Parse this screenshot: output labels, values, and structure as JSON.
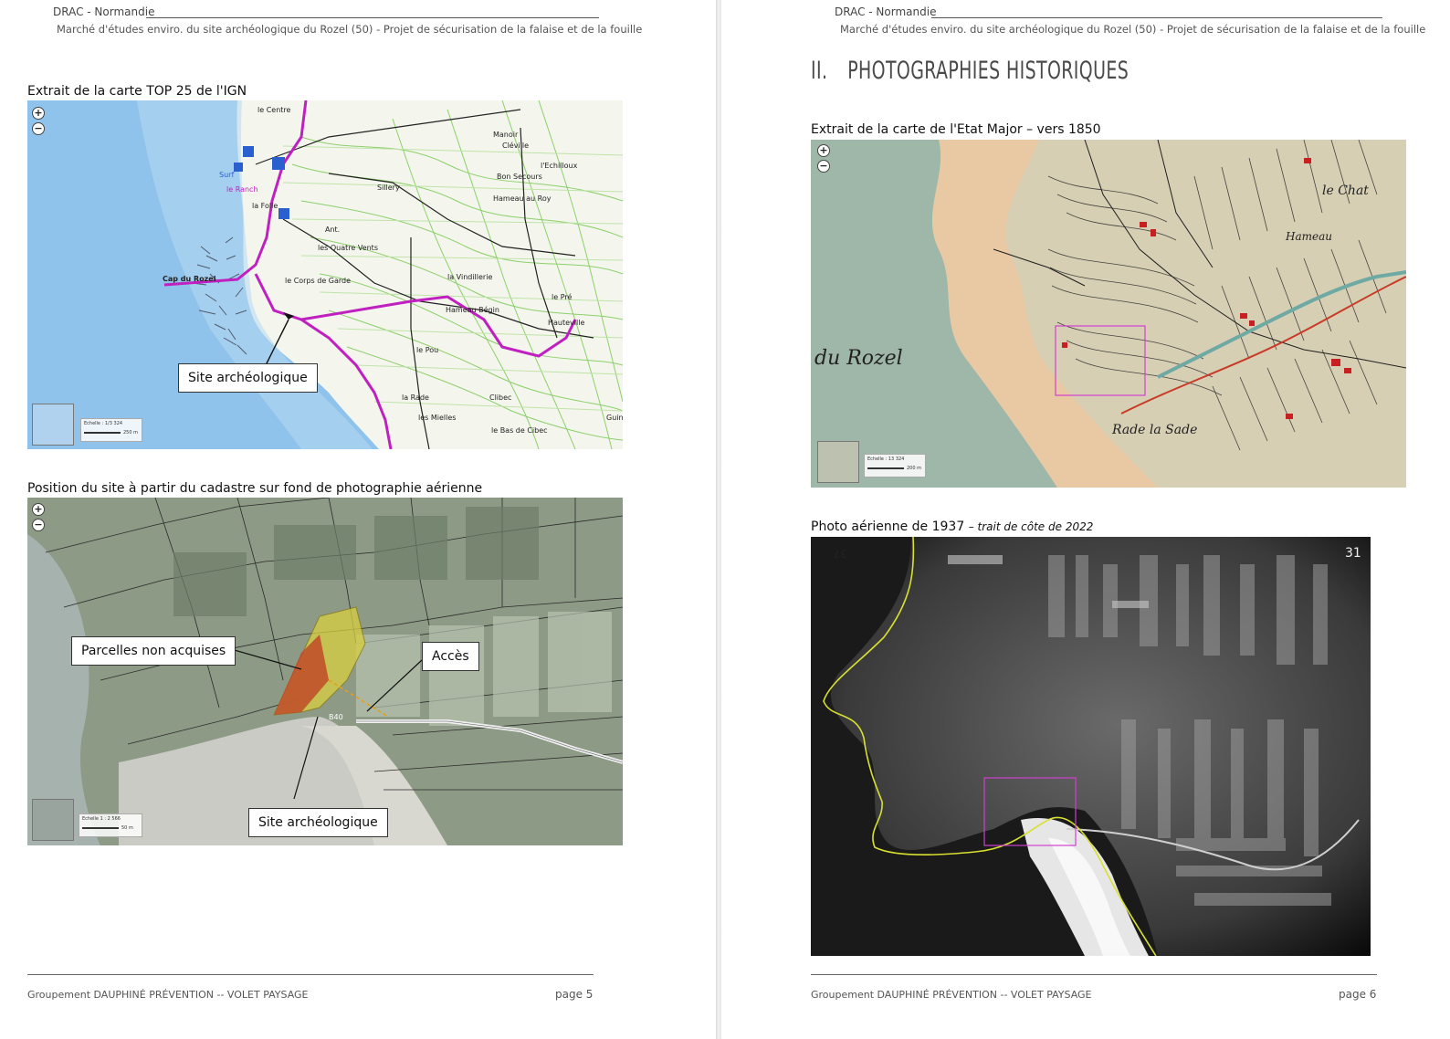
{
  "left_page": {
    "header": {
      "org": "DRAC - Normandie",
      "subtitle": "Marché d'études enviro. du site archéologique du Rozel (50) - Projet de sécurisation  de la falaise et de la fouille"
    },
    "figure1": {
      "caption": "Extrait de la carte TOP 25 de l'IGN",
      "callout": "Site archéologique",
      "map_labels": [
        "le Centre",
        "Cléville",
        "Sillery",
        "Hameau au Roy",
        "Cap du Rozel",
        "le Corps de Garde",
        "la Vindillerie",
        "Hameau Bégin",
        "Hauteville",
        "le Pou",
        "la Rade",
        "les Mielles",
        "le Bas de Cibec",
        "la Folie",
        "les Quatre Vents",
        "Ant.",
        "Bon Secours",
        "l'Echilloux",
        "Manoir",
        "Clibec",
        "le Pré",
        "Guin",
        "Surf",
        "le Ranch"
      ],
      "scale_text": "Echelle : 1/3 324",
      "scale_bar": "250 m",
      "zoom_in": "+",
      "zoom_out": "−"
    },
    "figure2": {
      "caption": "Position du site à partir du cadastre sur fond de photographie aérienne",
      "callouts": {
        "parcels": "Parcelles non acquises",
        "access": "Accès",
        "site": "Site archéologique"
      },
      "parcel_code": "B40",
      "scale_text": "Echelle 1 : 2 566",
      "scale_bar": "50 m",
      "zoom_in": "+",
      "zoom_out": "−"
    },
    "footer": {
      "left": "Groupement DAUPHINÉ PRÉVENTION  --  VOLET PAYSAGE",
      "right": "page 5"
    }
  },
  "right_page": {
    "header": {
      "org": "DRAC - Normandie",
      "subtitle": "Marché d'études enviro. du site archéologique du Rozel (50) - Projet de sécurisation  de la falaise et de la fouille"
    },
    "section": {
      "number": "II.",
      "title": "PHOTOGRAPHIES HISTORIQUES"
    },
    "figure1": {
      "caption": "Extrait de la carte de l'Etat Major – vers 1850",
      "map_labels": [
        "du Rozel",
        "Rade la Sade",
        "Hameau",
        "le Chat"
      ],
      "scale_text": "Echelle : 13 324",
      "scale_bar": "200 m",
      "zoom_in": "+",
      "zoom_out": "−"
    },
    "figure2": {
      "caption": "Photo aérienne de 1937",
      "caption_note": "– trait de côte de 2022",
      "photo_marks": [
        "37",
        "31"
      ]
    },
    "footer": {
      "left": "Groupement DAUPHINÉ PRÉVENTION  --  VOLET PAYSAGE",
      "right": "page 6"
    }
  },
  "colors": {
    "sea_ign": "#8fc3ec",
    "land_ign": "#f4f6ee",
    "road_magenta": "#c020c0",
    "contour_green": "#8ccf6a",
    "sand_old": "#e9c9a4",
    "sea_old": "#9fb7a8",
    "highlight_box": "#d040d0",
    "coastline_2022": "#d8e030"
  }
}
